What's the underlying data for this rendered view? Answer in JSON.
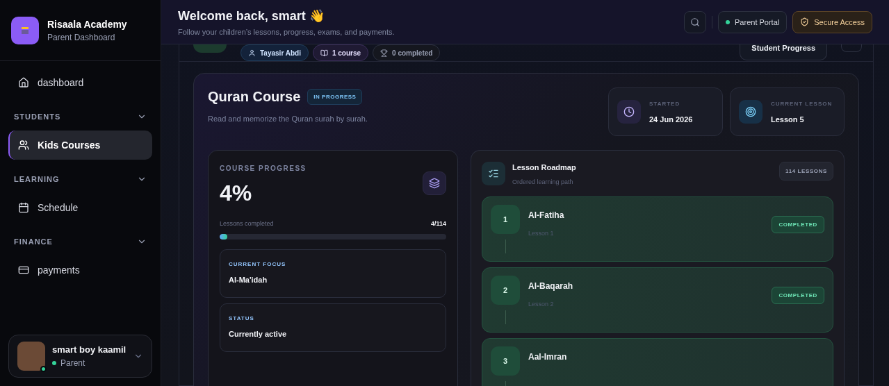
{
  "brand": {
    "name": "Risaala Academy",
    "subtitle": "Parent Dashboard"
  },
  "nav": [
    {
      "kind": "link",
      "label": "dashboard",
      "selected": false
    },
    {
      "kind": "section",
      "label": "STUDENTS",
      "expanded": true
    },
    {
      "kind": "link",
      "label": "Kids Courses",
      "selected": true
    },
    {
      "kind": "section",
      "label": "LEARNING",
      "expanded": true
    },
    {
      "kind": "link",
      "label": "Schedule",
      "selected": false
    },
    {
      "kind": "section",
      "label": "FINANCE",
      "expanded": true
    },
    {
      "kind": "link",
      "label": "payments",
      "selected": false
    }
  ],
  "user": {
    "name": "smart boy kaamil",
    "role": "Parent",
    "online": true
  },
  "header": {
    "title": "Welcome back, smart",
    "emoji": "👋",
    "subtitle": "Follow your children’s lessons, progress, exams, and payments.",
    "portal": "Parent Portal",
    "secure": "Secure Access"
  },
  "student": {
    "chips": [
      {
        "kind": "student",
        "label": "Tayasir Abdi"
      },
      {
        "kind": "courses",
        "label": "1 course"
      },
      {
        "kind": "completed",
        "label": "0 completed"
      }
    ],
    "progress_button": "Student Progress"
  },
  "course": {
    "title": "Quran Course",
    "status": "IN PROGRESS",
    "description": "Read and memorize the Quran surah by surah.",
    "stats": [
      {
        "kind": "started",
        "label": "STARTED",
        "value": "24 Jun 2026"
      },
      {
        "kind": "lesson",
        "label": "CURRENT LESSON",
        "value": "Lesson 5"
      }
    ],
    "progress": {
      "label": "COURSE PROGRESS",
      "percent": "4%",
      "lessons_label": "Lessons completed",
      "lessons_count": "4/114",
      "level": 0.035
    },
    "info": [
      {
        "label": "CURRENT FOCUS",
        "value": "Al-Ma'idah"
      },
      {
        "label": "STATUS",
        "value": "Currently active"
      }
    ],
    "roadmap": {
      "title": "Lesson Roadmap",
      "subtitle": "Ordered learning path",
      "count": "114 LESSONS",
      "lessons": [
        {
          "number": "1",
          "name": "Al-Fatiha",
          "sub": "Lesson 1",
          "completed": true,
          "badge": "COMPLETED"
        },
        {
          "number": "2",
          "name": "Al-Baqarah",
          "sub": "Lesson 2",
          "completed": true,
          "badge": "COMPLETED"
        },
        {
          "number": "3",
          "name": "Aal-Imran",
          "completed": true
        }
      ]
    }
  }
}
